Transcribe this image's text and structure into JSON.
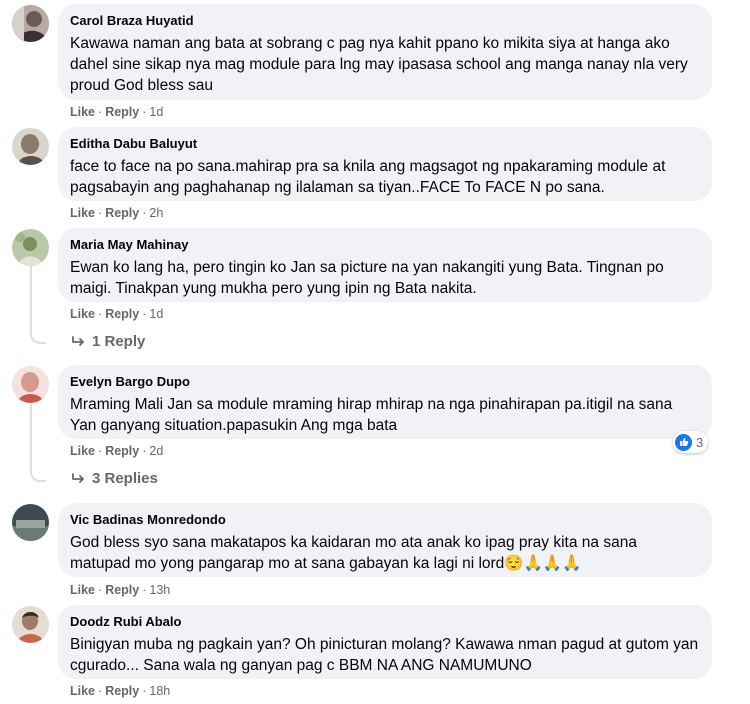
{
  "comments": [
    {
      "author": "Carol Braza Huyatid",
      "text": "Kawawa naman ang bata at sobrang c pag nya kahit ppano ko mikita siya at hanga ako dahel sine sikap nya mag module para lng may ipasasa school ang manga nanay nla very proud God bless sau",
      "like": "Like",
      "reply": "Reply",
      "time": "1d"
    },
    {
      "author": "Editha Dabu Baluyut",
      "text": "face to face na po sana.mahirap pra sa knila ang magsagot ng npakaraming module at pagsabayin ang paghahanap ng ilalaman sa tiyan..FACE To FACE N po sana.",
      "like": "Like",
      "reply": "Reply",
      "time": "2h"
    },
    {
      "author": "Maria May Mahinay",
      "text": "Ewan ko lang ha, pero tingin ko Jan sa picture na yan nakangiti yung Bata. Tingnan po maigi. Tinakpan yung mukha pero yung ipin ng Bata nakita.",
      "like": "Like",
      "reply": "Reply",
      "time": "1d",
      "replies_label": "1 Reply"
    },
    {
      "author": "Evelyn Bargo Dupo",
      "text": "Mraming Mali Jan sa module mraming hirap mhirap na nga pinahirapan pa.itigil na sana Yan ganyang situation.papasukin Ang mga bata",
      "like": "Like",
      "reply": "Reply",
      "time": "2d",
      "replies_label": "3 Replies",
      "reaction_count": "3"
    },
    {
      "author": "Vic Badinas Monredondo",
      "text": "God bless syo sana makatapos ka kaidaran mo ata anak ko ipag pray kita na sana matupad mo yong pangarap mo at sana gabayan ka lagi ni lord😌🙏🙏🙏",
      "like": "Like",
      "reply": "Reply",
      "time": "13h"
    },
    {
      "author": "Doodz Rubi Abalo",
      "text": "Binigyan muba ng pagkain yan? Oh pinicturan molang? Kawawa nman pagud at gutom yan cgurado... Sana wala ng ganyan pag c BBM NA ANG NAMUMUNO",
      "like": "Like",
      "reply": "Reply",
      "time": "18h"
    }
  ],
  "icons": {
    "reply_arrow": "reply-arrow-icon",
    "like_reaction": "like-reaction-icon"
  },
  "colors": {
    "bubble": "#f0f2f5",
    "meta": "#65676b",
    "like_blue": "#1877f2"
  }
}
